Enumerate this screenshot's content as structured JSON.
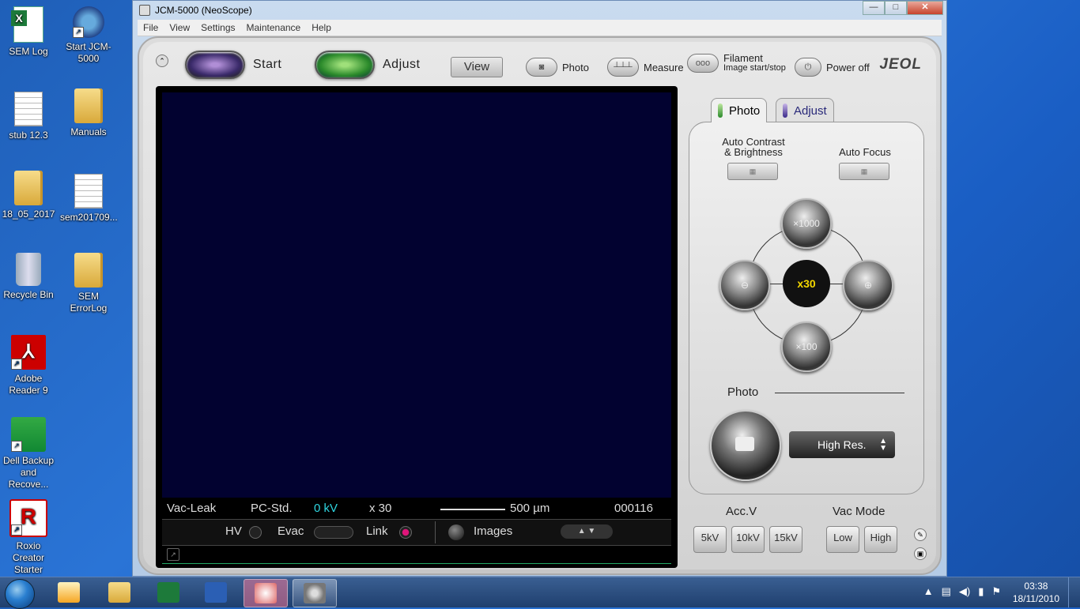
{
  "desktop_icons": [
    {
      "label": "SEM Log",
      "icon": "excel-icon"
    },
    {
      "label": "Start JCM-5000",
      "icon": "gear-icon"
    },
    {
      "label": "stub 12.3",
      "icon": "document-icon"
    },
    {
      "label": "Manuals",
      "icon": "folder-icon"
    },
    {
      "label": "18_05_2017",
      "icon": "folder-icon"
    },
    {
      "label": "sem201709...",
      "icon": "document-icon"
    },
    {
      "label": "Recycle Bin",
      "icon": "recycle-bin-icon"
    },
    {
      "label": "SEM ErrorLog",
      "icon": "folder-icon"
    },
    {
      "label": "Adobe Reader 9",
      "icon": "pdf-icon"
    },
    {
      "label": "Dell Backup and Recove...",
      "icon": "backup-icon"
    },
    {
      "label": "Roxio Creator Starter",
      "icon": "roxio-icon"
    }
  ],
  "window": {
    "title": "JCM-5000 (NeoScope)",
    "controls": {
      "minimize": "—",
      "maximize": "□",
      "close": "✕"
    }
  },
  "menu": [
    "File",
    "View",
    "Settings",
    "Maintenance",
    "Help"
  ],
  "toolbar": {
    "start_label": "Start",
    "adjust_label": "Adjust",
    "view_label": "View",
    "photo_label": "Photo",
    "measure_label": "Measure",
    "filament_label": "Filament",
    "filament_sub": "Image start/stop",
    "power_label": "Power off",
    "brand": "JEOL"
  },
  "status": {
    "vac": "Vac-Leak",
    "mode": "PC-Std.",
    "kv": "0 kV",
    "mag": "x 30",
    "scale": "500 µm",
    "counter": "000116",
    "hv_label": "HV",
    "evac_label": "Evac",
    "link_label": "Link",
    "images_label": "Images"
  },
  "tabs": {
    "photo": "Photo",
    "adjust": "Adjust"
  },
  "panel": {
    "auto_contrast_line1": "Auto Contrast",
    "auto_contrast_line2": "& Brightness",
    "auto_focus": "Auto Focus",
    "mag_top": "×1000",
    "mag_center": "x30",
    "mag_bottom": "×100",
    "photo_section": "Photo",
    "resolution": "High Res."
  },
  "acc_v": {
    "label": "Acc.V",
    "options": [
      "5kV",
      "10kV",
      "15kV"
    ]
  },
  "vac_mode": {
    "label": "Vac Mode",
    "options": [
      "Low",
      "High"
    ]
  },
  "clock": {
    "time": "03:38",
    "date": "18/11/2010"
  },
  "colors": {
    "accent_cyan": "#2fd5e0",
    "link_led": "#e0157a",
    "mag_yellow": "#f5d800"
  }
}
